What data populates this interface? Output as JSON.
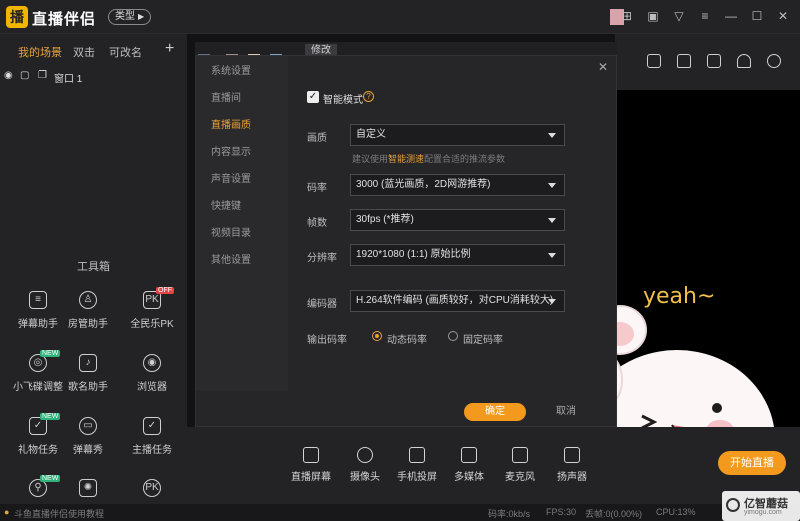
{
  "app": {
    "title": "直播伴侣",
    "type_label": "类型"
  },
  "scenes": {
    "tabs": [
      "我的场景",
      "双击",
      "可改名"
    ],
    "add": "+",
    "source_name": "窗口 1"
  },
  "toolbox": {
    "title": "工具箱",
    "items": [
      {
        "label": "弹幕助手",
        "icon": "danmaku-helper-icon",
        "glyph": "≡"
      },
      {
        "label": "房管助手",
        "icon": "room-admin-icon",
        "glyph": "♙"
      },
      {
        "label": "全民乐PK",
        "icon": "pk-icon",
        "glyph": "PK",
        "badge": "OFF"
      },
      {
        "label": "小飞碟调整",
        "icon": "ufo-icon",
        "glyph": "◎",
        "badge": "NEW"
      },
      {
        "label": "歌名助手",
        "icon": "song-helper-icon",
        "glyph": "♪"
      },
      {
        "label": "浏览器",
        "icon": "browser-icon",
        "glyph": "◉"
      },
      {
        "label": "礼物任务",
        "icon": "gift-task-icon",
        "glyph": "✓",
        "badge": "NEW"
      },
      {
        "label": "弹幕秀",
        "icon": "danmaku-show-icon",
        "glyph": "▭"
      },
      {
        "label": "主播任务",
        "icon": "anchor-task-icon",
        "glyph": "✓"
      },
      {
        "label": "",
        "icon": "magic-wand-icon",
        "glyph": "⚲",
        "badge": "NEW"
      },
      {
        "label": "",
        "icon": "lottery-icon",
        "glyph": "✺"
      },
      {
        "label": "",
        "icon": "pk-icon",
        "glyph": "PK"
      }
    ]
  },
  "dialog": {
    "tab_label": "修改",
    "nav": [
      "系统设置",
      "直播间",
      "直播画质",
      "内容显示",
      "声音设置",
      "快捷键",
      "视频目录",
      "其他设置"
    ],
    "active_nav": "直播画质",
    "smart_mode_label": "智能模式",
    "smart_mode_checked": true,
    "fields": [
      {
        "label": "画质",
        "value": "自定义"
      },
      {
        "label": "码率",
        "value": "3000 (蓝光画质，2D网游推荐)"
      },
      {
        "label": "帧数",
        "value": "30fps (*推荐)"
      },
      {
        "label": "分辨率",
        "value": "1920*1080 (1:1) 原始比例"
      },
      {
        "label": "编码器",
        "value": "H.264软件编码 (画质较好，对CPU消耗较大)"
      }
    ],
    "hint_prefix": "建议使用",
    "hint_link": "智能测速",
    "hint_suffix": "配置合适的推流参数",
    "output_label": "输出码率",
    "radio_options": [
      "动态码率",
      "固定码率"
    ],
    "radio_selected": "动态码率",
    "ok_label": "确定",
    "cancel_label": "取消"
  },
  "bottom_tools": [
    {
      "label": "直播屏幕",
      "icon": "screen-capture-icon"
    },
    {
      "label": "摄像头",
      "icon": "camera-icon"
    },
    {
      "label": "手机投屏",
      "icon": "phone-cast-icon"
    },
    {
      "label": "多媒体",
      "icon": "multimedia-icon"
    },
    {
      "label": "麦克风",
      "icon": "microphone-icon"
    },
    {
      "label": "扬声器",
      "icon": "speaker-icon"
    }
  ],
  "start_live_label": "开始直播",
  "preview": {
    "sticker_text": "yeah~"
  },
  "status": {
    "tutorial": "斗鱼直播伴侣使用教程",
    "bitrate": "码率:0kb/s",
    "fps": "FPS:30",
    "dropped": "丢帧:0(0.00%)",
    "cpu": "CPU:13%"
  },
  "watermark": {
    "line1": "亿智蘑菇",
    "line2": "yimogu.com"
  },
  "colors": {
    "accent": "#f39a1e",
    "active_text": "#e8a13a",
    "panel": "#232326",
    "dialog": "#262629"
  }
}
